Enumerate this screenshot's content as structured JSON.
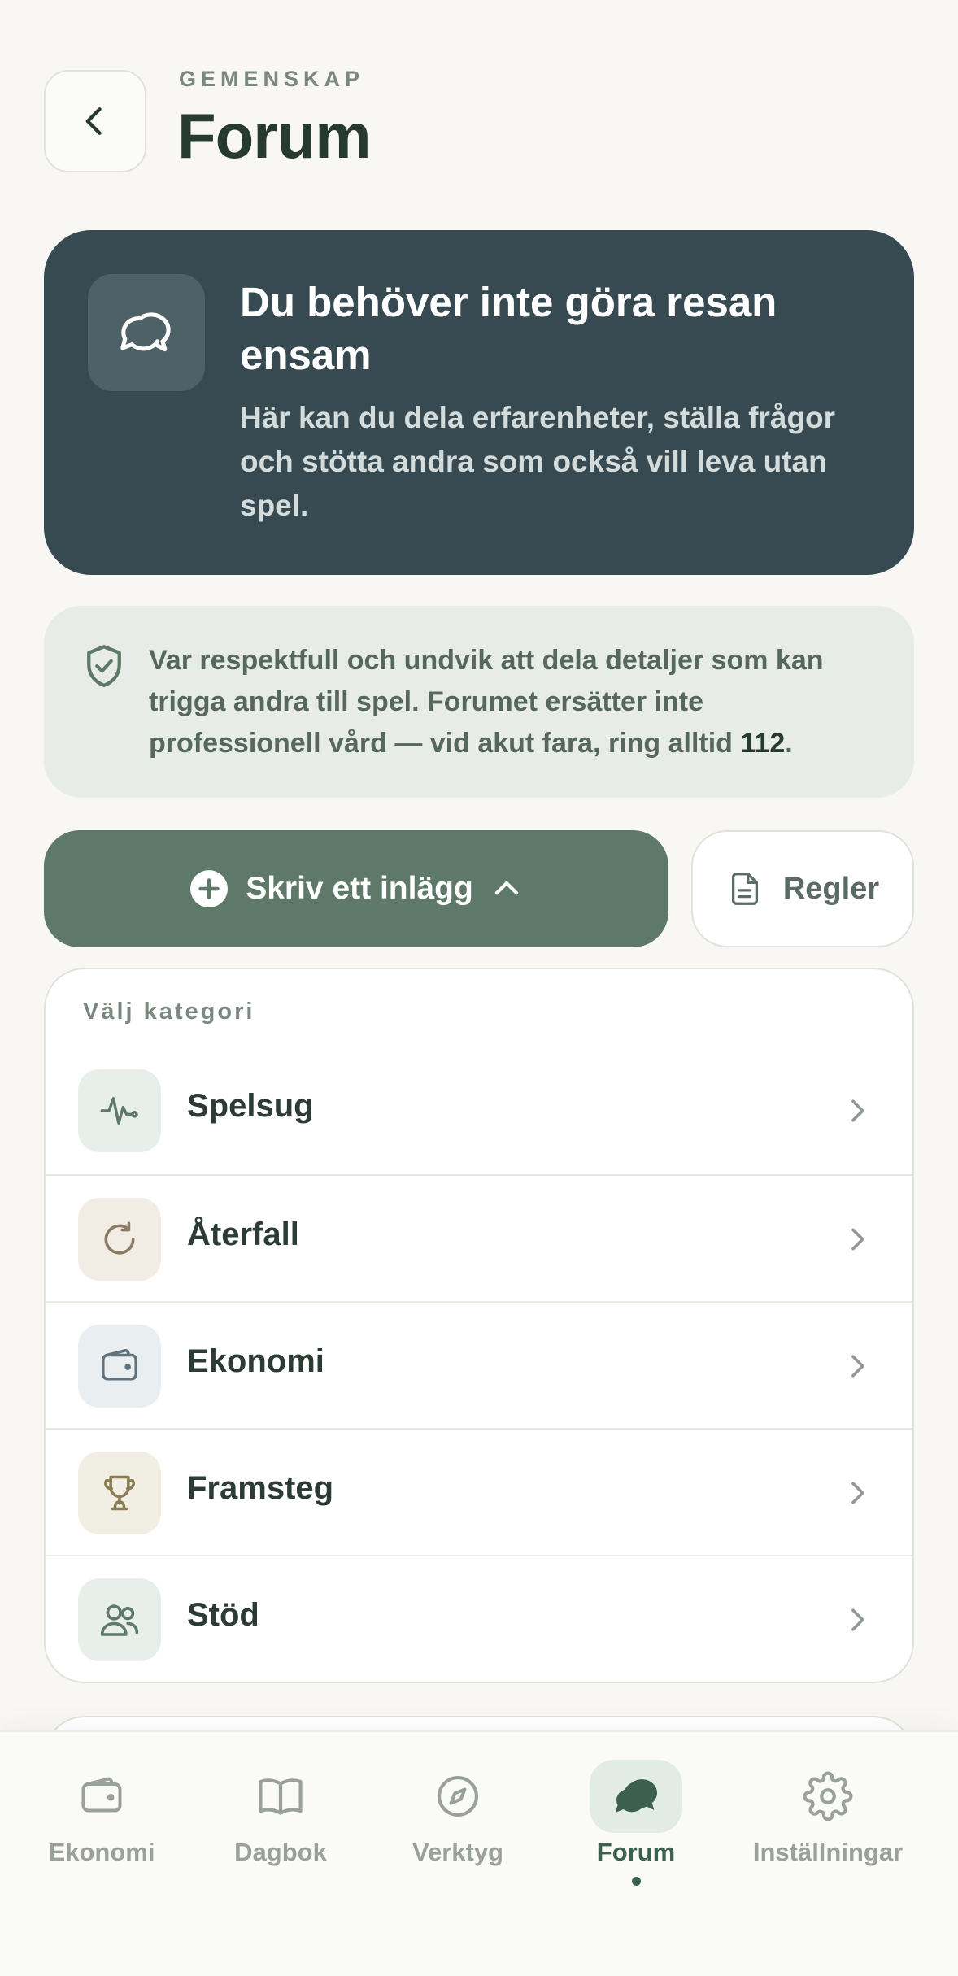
{
  "header": {
    "eyebrow": "GEMENSKAP",
    "title": "Forum"
  },
  "hero": {
    "title": "Du behöver inte göra resan ensam",
    "text": "Här kan du dela erfarenheter, ställa frågor och stötta andra som också vill leva utan spel."
  },
  "notice": {
    "text": "Var respektfull och undvik att dela detaljer som kan trigga andra till spel. Forumet ersätter inte professionell vård — vid akut fara, ring alltid ",
    "emergency_number": "112",
    "suffix": "."
  },
  "actions": {
    "write_label": "Skriv ett inlägg",
    "rules_label": "Regler"
  },
  "categories": {
    "heading": "Välj kategori",
    "items": [
      {
        "label": "Spelsug",
        "icon": "activity-icon",
        "bg": "#e8efeb",
        "color": "#5e7869"
      },
      {
        "label": "Återfall",
        "icon": "refresh-icon",
        "bg": "#f1ece4",
        "color": "#8a7a62"
      },
      {
        "label": "Ekonomi",
        "icon": "wallet-icon",
        "bg": "#e9eef1",
        "color": "#62727c"
      },
      {
        "label": "Framsteg",
        "icon": "trophy-icon",
        "bg": "#f1efe3",
        "color": "#8a7d54"
      },
      {
        "label": "Stöd",
        "icon": "users-icon",
        "bg": "#e8efeb",
        "color": "#5e7869"
      }
    ]
  },
  "nav": {
    "items": [
      {
        "label": "Ekonomi",
        "icon": "wallet-icon",
        "active": false
      },
      {
        "label": "Dagbok",
        "icon": "book-icon",
        "active": false
      },
      {
        "label": "Verktyg",
        "icon": "compass-icon",
        "active": false
      },
      {
        "label": "Forum",
        "icon": "chat-bubbles-icon",
        "active": true
      },
      {
        "label": "Inställningar",
        "icon": "gear-icon",
        "active": false
      }
    ]
  },
  "colors": {
    "background": "#f8f7f3",
    "hero": "#384a51",
    "accent": "#5e7869",
    "nav_active": "#3b604d"
  }
}
